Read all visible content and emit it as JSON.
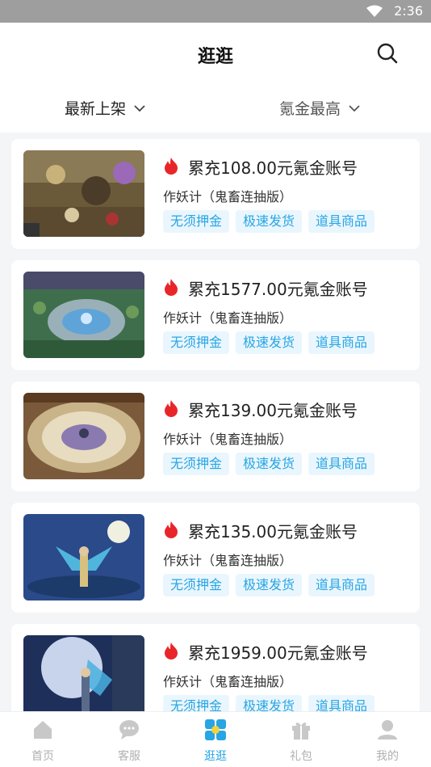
{
  "status": {
    "time": "2:36",
    "wifi_icon": "wifi-icon"
  },
  "header": {
    "title": "逛逛",
    "search_icon": "search-icon"
  },
  "filters": {
    "sort_label": "最新上架",
    "filter_label": "氪金最高"
  },
  "listings": [
    {
      "title": "累充108.00元氪金账号",
      "game": "作妖计（鬼畜连抽版）",
      "tags": [
        "无须押金",
        "极速发货",
        "道具商品"
      ]
    },
    {
      "title": "累充1577.00元氪金账号",
      "game": "作妖计（鬼畜连抽版）",
      "tags": [
        "无须押金",
        "极速发货",
        "道具商品"
      ]
    },
    {
      "title": "累充139.00元氪金账号",
      "game": "作妖计（鬼畜连抽版）",
      "tags": [
        "无须押金",
        "极速发货",
        "道具商品"
      ]
    },
    {
      "title": "累充135.00元氪金账号",
      "game": "作妖计（鬼畜连抽版）",
      "tags": [
        "无须押金",
        "极速发货",
        "道具商品"
      ]
    },
    {
      "title": "累充1959.00元氪金账号",
      "game": "作妖计（鬼畜连抽版）",
      "tags": [
        "无须押金",
        "极速发货",
        "道具商品"
      ]
    }
  ],
  "tabbar": {
    "items": [
      {
        "label": "首页",
        "icon": "home-icon"
      },
      {
        "label": "客服",
        "icon": "chat-bubble-icon"
      },
      {
        "label": "逛逛",
        "icon": "browse-grid-icon",
        "active": true
      },
      {
        "label": "礼包",
        "icon": "gift-icon"
      },
      {
        "label": "我的",
        "icon": "user-icon"
      }
    ]
  },
  "colors": {
    "accent": "#27a5e4",
    "flame": "#e8262a",
    "inactive": "#b0b0b0"
  }
}
